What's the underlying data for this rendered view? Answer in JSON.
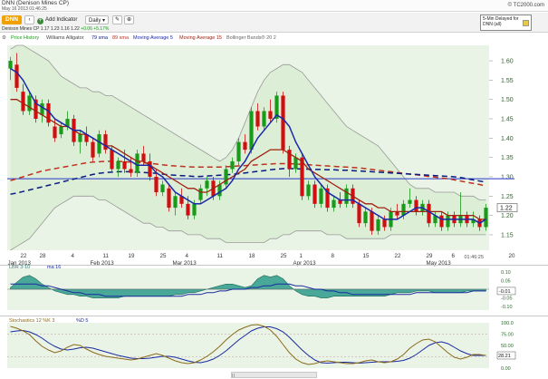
{
  "header": {
    "title": "DNN (Denison Mines CP)",
    "date": "May 16 2013 01:46:25",
    "copyright": "© TC2000.com"
  },
  "toolbar": {
    "ticker": "DNN",
    "add_indicator": "Add Indicator",
    "period": "Daily",
    "quote": "Denison Mines CP  1.17  1.23  1.16  1.22",
    "change": "+0.06  +5.17%",
    "delayed": "5-Min Delayed for DNN (all)"
  },
  "legend": {
    "price_history": "Price History",
    "alligator": "Williams Alligator",
    "sma79": "79 sma",
    "sma89": "89 sma",
    "ma5": "Moving Average 5",
    "ma15": "Moving Average 15",
    "bollinger": "Bollinger Bands® 20 2"
  },
  "colors": {
    "up": "#1a9a1a",
    "down": "#d01010",
    "ma5": "#1a28a8",
    "ma15": "#a02010",
    "sma79": "#0a1a80",
    "sma89": "#c03020",
    "bollinger": "#999999",
    "panel_bg": "#eaf4e6",
    "lbr_fill": "#2e9a8a",
    "stoch_k": "#8b6a1a",
    "stoch_d": "#1a2aa0",
    "hline": "#2838c8"
  },
  "chart_data": {
    "type": "candlestick",
    "price_axis": {
      "ymin": 1.11,
      "ymax": 1.64,
      "ticks": [
        "1.60",
        "1.55",
        "1.50",
        "1.45",
        "1.40",
        "1.35",
        "1.30",
        "1.25",
        "1.20",
        "1.15"
      ]
    },
    "last_price_label": "1.22",
    "horizontal_line": 1.295,
    "x_day_labels": [
      {
        "i": 2,
        "t": "22"
      },
      {
        "i": 5,
        "t": "28"
      },
      {
        "i": 10,
        "t": "4"
      },
      {
        "i": 15,
        "t": "11"
      },
      {
        "i": 19,
        "t": "19"
      },
      {
        "i": 24,
        "t": "25"
      },
      {
        "i": 28,
        "t": "4"
      },
      {
        "i": 33,
        "t": "11"
      },
      {
        "i": 38,
        "t": "18"
      },
      {
        "i": 43,
        "t": "25"
      },
      {
        "i": 46,
        "t": "1"
      },
      {
        "i": 51,
        "t": "8"
      },
      {
        "i": 56,
        "t": "15"
      },
      {
        "i": 61,
        "t": "22"
      },
      {
        "i": 66,
        "t": "29"
      },
      {
        "i": 70,
        "t": "6"
      },
      {
        "i": 79,
        "t": "20"
      }
    ],
    "x_month_labels": [
      {
        "i": 0,
        "t": "Jan 2013"
      },
      {
        "i": 13,
        "t": "Feb 2013"
      },
      {
        "i": 26,
        "t": "Mar 2013"
      },
      {
        "i": 45,
        "t": "Apr 2013"
      },
      {
        "i": 66,
        "t": "May 2013"
      }
    ],
    "time_label": "01:46:25",
    "candles": [
      [
        1.58,
        1.61,
        1.55,
        1.6
      ],
      [
        1.59,
        1.62,
        1.52,
        1.53
      ],
      [
        1.52,
        1.54,
        1.46,
        1.47
      ],
      [
        1.47,
        1.52,
        1.46,
        1.51
      ],
      [
        1.5,
        1.51,
        1.44,
        1.45
      ],
      [
        1.46,
        1.5,
        1.44,
        1.49
      ],
      [
        1.49,
        1.5,
        1.43,
        1.44
      ],
      [
        1.43,
        1.45,
        1.39,
        1.4
      ],
      [
        1.41,
        1.44,
        1.4,
        1.43
      ],
      [
        1.43,
        1.47,
        1.42,
        1.45
      ],
      [
        1.45,
        1.46,
        1.38,
        1.39
      ],
      [
        1.39,
        1.42,
        1.36,
        1.41
      ],
      [
        1.41,
        1.43,
        1.38,
        1.39
      ],
      [
        1.39,
        1.4,
        1.34,
        1.35
      ],
      [
        1.36,
        1.42,
        1.35,
        1.41
      ],
      [
        1.41,
        1.42,
        1.36,
        1.37
      ],
      [
        1.37,
        1.38,
        1.31,
        1.32
      ],
      [
        1.32,
        1.35,
        1.3,
        1.34
      ],
      [
        1.34,
        1.37,
        1.31,
        1.32
      ],
      [
        1.32,
        1.35,
        1.3,
        1.31
      ],
      [
        1.31,
        1.37,
        1.3,
        1.36
      ],
      [
        1.36,
        1.38,
        1.33,
        1.34
      ],
      [
        1.34,
        1.36,
        1.29,
        1.3
      ],
      [
        1.3,
        1.32,
        1.25,
        1.26
      ],
      [
        1.26,
        1.29,
        1.25,
        1.28
      ],
      [
        1.27,
        1.28,
        1.21,
        1.22
      ],
      [
        1.22,
        1.26,
        1.2,
        1.25
      ],
      [
        1.25,
        1.27,
        1.22,
        1.23
      ],
      [
        1.23,
        1.25,
        1.19,
        1.2
      ],
      [
        1.2,
        1.24,
        1.19,
        1.23
      ],
      [
        1.24,
        1.28,
        1.23,
        1.27
      ],
      [
        1.27,
        1.3,
        1.25,
        1.29
      ],
      [
        1.29,
        1.3,
        1.24,
        1.25
      ],
      [
        1.25,
        1.29,
        1.24,
        1.28
      ],
      [
        1.28,
        1.33,
        1.27,
        1.32
      ],
      [
        1.32,
        1.35,
        1.31,
        1.34
      ],
      [
        1.34,
        1.4,
        1.33,
        1.39
      ],
      [
        1.39,
        1.41,
        1.36,
        1.37
      ],
      [
        1.37,
        1.48,
        1.36,
        1.47
      ],
      [
        1.47,
        1.49,
        1.42,
        1.43
      ],
      [
        1.43,
        1.48,
        1.42,
        1.47
      ],
      [
        1.47,
        1.5,
        1.44,
        1.45
      ],
      [
        1.45,
        1.52,
        1.44,
        1.51
      ],
      [
        1.51,
        1.52,
        1.36,
        1.37
      ],
      [
        1.37,
        1.38,
        1.3,
        1.32
      ],
      [
        1.32,
        1.36,
        1.31,
        1.35
      ],
      [
        1.35,
        1.36,
        1.24,
        1.25
      ],
      [
        1.25,
        1.29,
        1.24,
        1.28
      ],
      [
        1.28,
        1.29,
        1.22,
        1.23
      ],
      [
        1.23,
        1.28,
        1.22,
        1.27
      ],
      [
        1.27,
        1.28,
        1.21,
        1.22
      ],
      [
        1.22,
        1.25,
        1.21,
        1.24
      ],
      [
        1.24,
        1.26,
        1.22,
        1.23
      ],
      [
        1.23,
        1.28,
        1.22,
        1.27
      ],
      [
        1.27,
        1.28,
        1.22,
        1.23
      ],
      [
        1.23,
        1.24,
        1.17,
        1.18
      ],
      [
        1.18,
        1.22,
        1.17,
        1.21
      ],
      [
        1.21,
        1.22,
        1.15,
        1.16
      ],
      [
        1.16,
        1.2,
        1.15,
        1.19
      ],
      [
        1.19,
        1.2,
        1.16,
        1.17
      ],
      [
        1.17,
        1.22,
        1.16,
        1.21
      ],
      [
        1.21,
        1.23,
        1.19,
        1.2
      ],
      [
        1.2,
        1.24,
        1.19,
        1.23
      ],
      [
        1.23,
        1.27,
        1.22,
        1.24
      ],
      [
        1.24,
        1.25,
        1.2,
        1.21
      ],
      [
        1.21,
        1.24,
        1.2,
        1.23
      ],
      [
        1.23,
        1.24,
        1.17,
        1.18
      ],
      [
        1.18,
        1.21,
        1.17,
        1.2
      ],
      [
        1.2,
        1.21,
        1.16,
        1.17
      ],
      [
        1.17,
        1.21,
        1.16,
        1.2
      ],
      [
        1.2,
        1.21,
        1.17,
        1.18
      ],
      [
        1.18,
        1.26,
        1.17,
        1.2
      ],
      [
        1.2,
        1.21,
        1.17,
        1.18
      ],
      [
        1.18,
        1.21,
        1.17,
        1.19
      ],
      [
        1.19,
        1.2,
        1.16,
        1.17
      ],
      [
        1.17,
        1.23,
        1.16,
        1.22
      ]
    ],
    "ma5": [
      1.58,
      1.57,
      1.55,
      1.52,
      1.49,
      1.48,
      1.47,
      1.45,
      1.44,
      1.43,
      1.42,
      1.42,
      1.41,
      1.4,
      1.39,
      1.38,
      1.37,
      1.36,
      1.35,
      1.34,
      1.33,
      1.33,
      1.33,
      1.31,
      1.3,
      1.28,
      1.26,
      1.25,
      1.24,
      1.23,
      1.23,
      1.24,
      1.25,
      1.26,
      1.27,
      1.29,
      1.32,
      1.34,
      1.37,
      1.4,
      1.42,
      1.44,
      1.46,
      1.45,
      1.43,
      1.39,
      1.36,
      1.33,
      1.3,
      1.28,
      1.26,
      1.25,
      1.24,
      1.24,
      1.24,
      1.23,
      1.22,
      1.21,
      1.2,
      1.19,
      1.19,
      1.19,
      1.2,
      1.21,
      1.22,
      1.22,
      1.21,
      1.2,
      1.19,
      1.19,
      1.19,
      1.19,
      1.19,
      1.19,
      1.18,
      1.19
    ],
    "ma15": [
      1.5,
      1.5,
      1.49,
      1.48,
      1.47,
      1.46,
      1.45,
      1.44,
      1.43,
      1.43,
      1.42,
      1.41,
      1.41,
      1.4,
      1.39,
      1.38,
      1.38,
      1.37,
      1.36,
      1.35,
      1.34,
      1.34,
      1.33,
      1.32,
      1.31,
      1.3,
      1.29,
      1.28,
      1.27,
      1.27,
      1.26,
      1.26,
      1.27,
      1.28,
      1.29,
      1.3,
      1.31,
      1.32,
      1.34,
      1.35,
      1.36,
      1.37,
      1.37,
      1.37,
      1.36,
      1.35,
      1.34,
      1.32,
      1.31,
      1.3,
      1.29,
      1.28,
      1.27,
      1.26,
      1.25,
      1.24,
      1.23,
      1.23,
      1.22,
      1.22,
      1.21,
      1.21,
      1.21,
      1.21,
      1.21,
      1.21,
      1.21,
      1.21,
      1.21,
      1.2,
      1.2,
      1.2,
      1.2,
      1.2,
      1.19,
      1.19
    ],
    "sma79": [
      1.255,
      1.258,
      1.262,
      1.266,
      1.27,
      1.274,
      1.278,
      1.282,
      1.286,
      1.29,
      1.294,
      1.298,
      1.302,
      1.306,
      1.309,
      1.311,
      1.312,
      1.313,
      1.313,
      1.313,
      1.312,
      1.311,
      1.31,
      1.309,
      1.307,
      1.305,
      1.304,
      1.303,
      1.302,
      1.301,
      1.301,
      1.302,
      1.303,
      1.304,
      1.305,
      1.306,
      1.308,
      1.31,
      1.312,
      1.314,
      1.316,
      1.318,
      1.32,
      1.321,
      1.321,
      1.321,
      1.32,
      1.32,
      1.319,
      1.319,
      1.318,
      1.318,
      1.317,
      1.317,
      1.316,
      1.315,
      1.314,
      1.313,
      1.312,
      1.311,
      1.31,
      1.309,
      1.308,
      1.307,
      1.306,
      1.305,
      1.304,
      1.303,
      1.302,
      1.301,
      1.3,
      1.298,
      1.295,
      1.292,
      1.289,
      1.286
    ],
    "sma89": [
      1.29,
      1.295,
      1.3,
      1.305,
      1.31,
      1.315,
      1.318,
      1.321,
      1.324,
      1.327,
      1.33,
      1.333,
      1.336,
      1.338,
      1.339,
      1.34,
      1.34,
      1.34,
      1.339,
      1.338,
      1.337,
      1.336,
      1.335,
      1.333,
      1.331,
      1.329,
      1.328,
      1.327,
      1.326,
      1.325,
      1.325,
      1.325,
      1.325,
      1.325,
      1.326,
      1.327,
      1.328,
      1.329,
      1.33,
      1.331,
      1.332,
      1.333,
      1.334,
      1.334,
      1.334,
      1.333,
      1.332,
      1.331,
      1.33,
      1.329,
      1.328,
      1.327,
      1.326,
      1.325,
      1.324,
      1.323,
      1.321,
      1.319,
      1.317,
      1.315,
      1.313,
      1.311,
      1.309,
      1.307,
      1.305,
      1.303,
      1.301,
      1.299,
      1.297,
      1.295,
      1.292,
      1.289,
      1.286,
      1.283,
      1.28,
      1.276
    ],
    "bb_upper": [
      1.63,
      1.64,
      1.64,
      1.63,
      1.62,
      1.61,
      1.6,
      1.58,
      1.56,
      1.55,
      1.54,
      1.53,
      1.53,
      1.52,
      1.52,
      1.51,
      1.51,
      1.5,
      1.49,
      1.48,
      1.47,
      1.46,
      1.45,
      1.44,
      1.43,
      1.42,
      1.41,
      1.4,
      1.39,
      1.38,
      1.37,
      1.36,
      1.35,
      1.34,
      1.35,
      1.37,
      1.4,
      1.44,
      1.48,
      1.52,
      1.55,
      1.57,
      1.58,
      1.59,
      1.59,
      1.58,
      1.57,
      1.55,
      1.53,
      1.51,
      1.49,
      1.47,
      1.45,
      1.43,
      1.42,
      1.41,
      1.4,
      1.39,
      1.38,
      1.36,
      1.34,
      1.32,
      1.3,
      1.28,
      1.27,
      1.27,
      1.27,
      1.26,
      1.26,
      1.26,
      1.26,
      1.25,
      1.25,
      1.25,
      1.24,
      1.24
    ],
    "bb_lower": [
      1.11,
      1.12,
      1.13,
      1.14,
      1.16,
      1.18,
      1.2,
      1.22,
      1.23,
      1.24,
      1.25,
      1.25,
      1.25,
      1.25,
      1.24,
      1.24,
      1.23,
      1.22,
      1.21,
      1.2,
      1.19,
      1.18,
      1.18,
      1.17,
      1.17,
      1.16,
      1.16,
      1.16,
      1.15,
      1.15,
      1.15,
      1.14,
      1.14,
      1.14,
      1.13,
      1.13,
      1.13,
      1.13,
      1.13,
      1.13,
      1.13,
      1.14,
      1.14,
      1.15,
      1.15,
      1.16,
      1.16,
      1.16,
      1.16,
      1.16,
      1.15,
      1.15,
      1.15,
      1.14,
      1.14,
      1.14,
      1.14,
      1.14,
      1.14,
      1.14,
      1.15,
      1.15,
      1.15,
      1.15,
      1.15,
      1.15,
      1.15,
      1.15,
      1.15,
      1.15,
      1.15,
      1.15,
      1.15,
      1.15,
      1.15,
      1.15
    ],
    "lbr": {
      "label": "LBR 3-10",
      "ma_label": "ma 16",
      "ticks": [
        "0.10",
        "0.05",
        "0.00",
        "-0.05",
        "-0.10"
      ],
      "ymin": -0.12,
      "ymax": 0.12,
      "current_label": "-0.01",
      "osc": [
        0.01,
        0.04,
        0.07,
        0.08,
        0.06,
        0.03,
        0.01,
        -0.01,
        -0.02,
        -0.03,
        -0.03,
        -0.04,
        -0.04,
        -0.05,
        -0.05,
        -0.05,
        -0.05,
        -0.05,
        -0.04,
        -0.04,
        -0.04,
        -0.04,
        -0.04,
        -0.04,
        -0.04,
        -0.04,
        -0.03,
        -0.03,
        -0.02,
        -0.02,
        -0.01,
        0.0,
        0.01,
        0.02,
        0.03,
        0.03,
        0.02,
        0.01,
        0.02,
        0.06,
        0.08,
        0.07,
        0.08,
        0.06,
        0.02,
        -0.01,
        -0.03,
        -0.04,
        -0.04,
        -0.05,
        -0.05,
        -0.04,
        -0.04,
        -0.04,
        -0.04,
        -0.04,
        -0.04,
        -0.04,
        -0.04,
        -0.04,
        -0.03,
        -0.02,
        -0.02,
        -0.02,
        -0.01,
        -0.01,
        -0.01,
        -0.02,
        -0.02,
        -0.02,
        -0.02,
        -0.02,
        -0.01,
        -0.01,
        -0.01,
        -0.01
      ],
      "ma": [
        0.03,
        0.03,
        0.03,
        0.03,
        0.03,
        0.02,
        0.02,
        0.01,
        0.0,
        -0.01,
        -0.02,
        -0.02,
        -0.03,
        -0.03,
        -0.03,
        -0.04,
        -0.04,
        -0.04,
        -0.04,
        -0.04,
        -0.04,
        -0.04,
        -0.04,
        -0.04,
        -0.04,
        -0.04,
        -0.04,
        -0.04,
        -0.03,
        -0.03,
        -0.03,
        -0.02,
        -0.02,
        -0.01,
        -0.01,
        0.0,
        0.0,
        0.0,
        0.01,
        0.01,
        0.02,
        0.02,
        0.03,
        0.03,
        0.03,
        0.02,
        0.02,
        0.01,
        0.0,
        0.0,
        -0.01,
        -0.01,
        -0.02,
        -0.02,
        -0.03,
        -0.03,
        -0.03,
        -0.03,
        -0.03,
        -0.03,
        -0.03,
        -0.03,
        -0.03,
        -0.03,
        -0.02,
        -0.02,
        -0.02,
        -0.02,
        -0.02,
        -0.02,
        -0.02,
        -0.02,
        -0.02,
        -0.01,
        -0.01,
        -0.01
      ]
    },
    "stoch": {
      "label": "Stochastics 12 %K 3",
      "d_label": "%D 5",
      "ticks": [
        "100.0",
        "75.00",
        "50.00",
        "25.00",
        "0.00"
      ],
      "ymin": 0,
      "ymax": 100,
      "current_label": "28.21",
      "k": [
        92,
        88,
        82,
        74,
        60,
        48,
        40,
        34,
        38,
        46,
        52,
        50,
        42,
        35,
        30,
        26,
        24,
        22,
        20,
        18,
        20,
        24,
        28,
        32,
        28,
        22,
        16,
        12,
        10,
        12,
        18,
        26,
        36,
        48,
        62,
        74,
        84,
        90,
        95,
        96,
        92,
        84,
        70,
        52,
        34,
        20,
        12,
        8,
        10,
        14,
        16,
        14,
        12,
        10,
        10,
        12,
        16,
        18,
        14,
        12,
        14,
        20,
        30,
        44,
        54,
        62,
        64,
        58,
        46,
        34,
        24,
        20,
        24,
        30,
        30,
        28
      ],
      "d": [
        80,
        82,
        83,
        80,
        74,
        66,
        56,
        48,
        42,
        40,
        42,
        45,
        46,
        44,
        40,
        36,
        32,
        28,
        25,
        22,
        21,
        21,
        22,
        24,
        26,
        26,
        24,
        20,
        16,
        13,
        12,
        15,
        20,
        28,
        38,
        50,
        62,
        72,
        82,
        88,
        91,
        91,
        87,
        80,
        68,
        54,
        40,
        28,
        18,
        12,
        11,
        12,
        13,
        13,
        12,
        11,
        12,
        13,
        14,
        14,
        14,
        15,
        17,
        22,
        30,
        40,
        50,
        56,
        58,
        54,
        46,
        38,
        32,
        28,
        28,
        28
      ]
    }
  }
}
